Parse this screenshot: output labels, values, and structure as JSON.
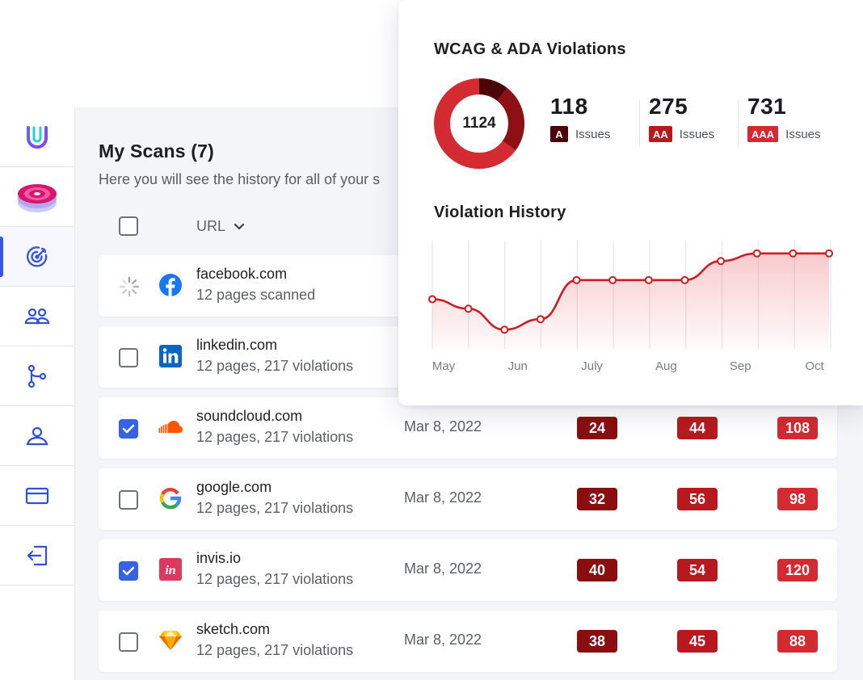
{
  "colors": {
    "level_a": "#8a0e10",
    "level_aa": "#b8191f",
    "level_aaa": "#d42a31",
    "accent": "#3a54e3"
  },
  "sidebar": {
    "items": [
      {
        "name": "logo",
        "icon": "u-logo-icon"
      },
      {
        "name": "product",
        "icon": "layers-target-icon"
      },
      {
        "name": "scans",
        "icon": "target-icon",
        "active": true
      },
      {
        "name": "team",
        "icon": "users-icon"
      },
      {
        "name": "integrations",
        "icon": "branch-icon"
      },
      {
        "name": "account",
        "icon": "user-icon"
      },
      {
        "name": "billing",
        "icon": "credit-card-icon"
      },
      {
        "name": "logout",
        "icon": "logout-icon"
      }
    ]
  },
  "page": {
    "title": "My Scans (7)",
    "subtitle": "Here you will see the history for all of your s"
  },
  "list": {
    "url_header": "URL",
    "rows": [
      {
        "domain": "facebook.com",
        "meta": "12 pages scanned",
        "status": "scanning",
        "logo": "facebook-logo-icon"
      },
      {
        "domain": "linkedin.com",
        "meta": "12 pages, 217 violations",
        "checked": false,
        "logo": "linkedin-logo-icon"
      },
      {
        "domain": "soundcloud.com",
        "meta": "12 pages, 217 violations",
        "date": "Mar 8, 2022",
        "a": "24",
        "aa": "44",
        "aaa": "108",
        "checked": true,
        "logo": "soundcloud-logo-icon"
      },
      {
        "domain": "google.com",
        "meta": "12 pages, 217 violations",
        "date": "Mar 8, 2022",
        "a": "32",
        "aa": "56",
        "aaa": "98",
        "checked": false,
        "logo": "google-logo-icon"
      },
      {
        "domain": "invis.io",
        "meta": "12 pages, 217 violations",
        "date": "Mar 8, 2022",
        "a": "40",
        "aa": "54",
        "aaa": "120",
        "checked": true,
        "logo": "invision-logo-icon"
      },
      {
        "domain": "sketch.com",
        "meta": "12 pages, 217 violations",
        "date": "Mar 8, 2022",
        "a": "38",
        "aa": "45",
        "aaa": "88",
        "checked": false,
        "logo": "sketch-logo-icon"
      }
    ]
  },
  "card": {
    "title": "WCAG & ADA Violations",
    "total": "1124",
    "stats": [
      {
        "count": "118",
        "level": "A",
        "label": "Issues"
      },
      {
        "count": "275",
        "level": "AA",
        "label": "Issues"
      },
      {
        "count": "731",
        "level": "AAA",
        "label": "Issues"
      }
    ],
    "history_title": "Violation History"
  },
  "chart_data": {
    "type": "area",
    "title": "Violation History",
    "x_labels": [
      "May",
      "Jun",
      "July",
      "Aug",
      "Sep",
      "Oct"
    ],
    "points": [
      {
        "x": 0,
        "y": 0.42
      },
      {
        "x": 0.5,
        "y": 0.32
      },
      {
        "x": 1.0,
        "y": 0.1
      },
      {
        "x": 1.5,
        "y": 0.21
      },
      {
        "x": 2.0,
        "y": 0.62
      },
      {
        "x": 2.5,
        "y": 0.62
      },
      {
        "x": 3.0,
        "y": 0.62
      },
      {
        "x": 3.5,
        "y": 0.62
      },
      {
        "x": 4.0,
        "y": 0.82
      },
      {
        "x": 4.5,
        "y": 0.9
      },
      {
        "x": 5.0,
        "y": 0.9
      },
      {
        "x": 5.5,
        "y": 0.9
      }
    ],
    "ylim": [
      0,
      1
    ],
    "grid": true,
    "line_color": "#cf1c24"
  }
}
